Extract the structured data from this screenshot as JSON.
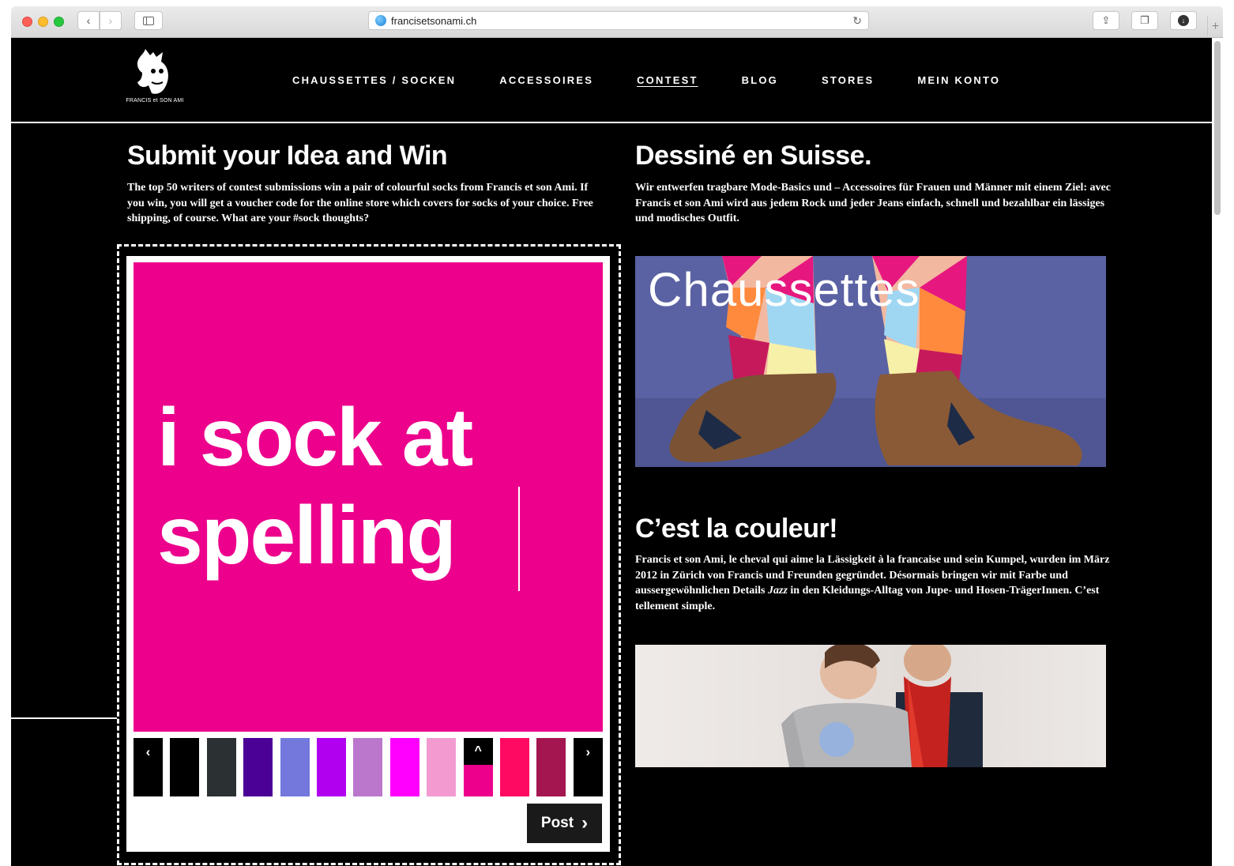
{
  "browser": {
    "url": "francisetsonami.ch"
  },
  "site": {
    "logo_text": "FRANCIS et SON AMI",
    "nav": [
      {
        "label": "CHAUSSETTES / SOCKEN"
      },
      {
        "label": "ACCESSOIRES"
      },
      {
        "label": "CONTEST",
        "active": true
      },
      {
        "label": "BLOG"
      },
      {
        "label": "STORES"
      },
      {
        "label": "MEIN KONTO"
      }
    ]
  },
  "contest": {
    "title": "Submit your Idea and Win",
    "body": "The top 50 writers of contest submissions win a pair of colourful socks from Francis et son Ami. If you win, you will get a voucher code for the online store which covers for socks of your choice. Free shipping, of course. What are your #sock thoughts?",
    "canvas_text_line1": "i sock at",
    "canvas_text_line2": "spelling",
    "canvas_color": "#ec008c",
    "swatches": [
      "#000000",
      "#2b3033",
      "#4b0096",
      "#7478dd",
      "#b100f0",
      "#bb77cc",
      "#ff00ff",
      "#f39bd1",
      "#ec008c",
      "#ff0a63",
      "#a4164f"
    ],
    "selected_swatch": "#ec008c",
    "post_label": "Post"
  },
  "right": {
    "section1_title": "Dessiné en Suisse.",
    "section1_body": "Wir entwerfen tragbare Mode-Basics und – Accessoires für Frauen und Männer mit einem Ziel: avec Francis et son Ami wird aus jedem Rock und jeder Jeans einfach, schnell und bezahlbar ein lässiges und modisches Outfit.",
    "photo1_label": "Chaussettes",
    "section2_title": "C’est la couleur!",
    "section2_body_a": "Francis et son Ami, le cheval qui aime la Lässigkeit à la francaise und sein Kumpel, wurden im März 2012 in Zürich von Francis und Freunden gegründet. Désormais bringen wir mit Farbe und aussergewöhnlichen Details ",
    "section2_body_em": "Jazz",
    "section2_body_b": " in den Kleidungs-Alltag von Jupe- und Hosen-TrägerInnen. C’est tellement simple."
  }
}
